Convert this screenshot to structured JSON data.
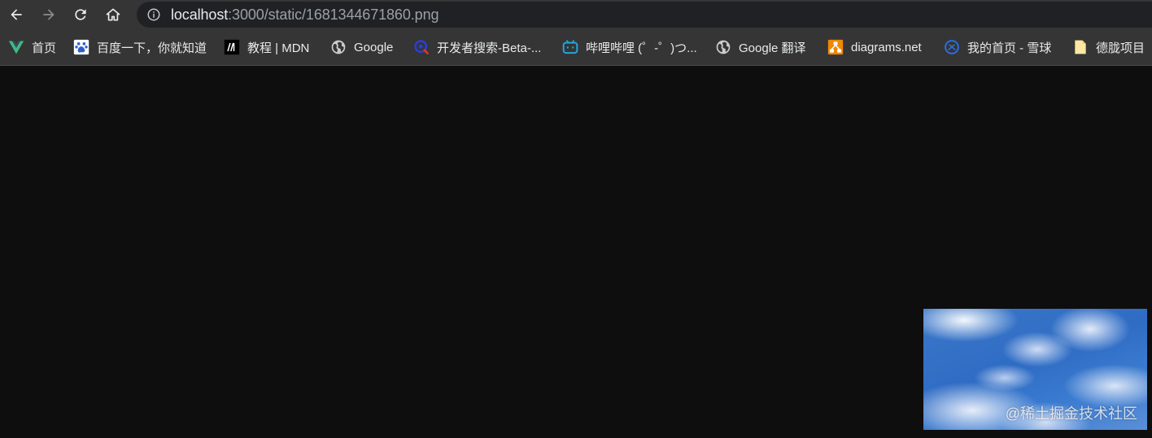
{
  "toolbar": {
    "back_icon": "arrow-left-icon",
    "forward_icon": "arrow-right-icon",
    "reload_icon": "reload-icon",
    "home_icon": "home-icon",
    "url_host": "localhost",
    "url_path": ":3000/static/1681344671860.png"
  },
  "bookmarks": [
    {
      "label": "首页",
      "icon": "vue-logo-icon"
    },
    {
      "label": "百度一下，你就知道",
      "icon": "baidu-paw-icon"
    },
    {
      "label": "教程 | MDN",
      "icon": "mdn-logo-icon"
    },
    {
      "label": "Google",
      "icon": "globe-icon"
    },
    {
      "label": "开发者搜索-Beta-...",
      "icon": "search-engine-icon"
    },
    {
      "label": "哔哩哔哩 (゜-゜)つ...",
      "icon": "bilibili-tv-icon"
    },
    {
      "label": "Google 翻译",
      "icon": "globe-icon"
    },
    {
      "label": "diagrams.net",
      "icon": "diagrams-logo-icon"
    },
    {
      "label": "我的首页 - 雪球",
      "icon": "xueqiu-logo-icon"
    },
    {
      "label": "德胧项目",
      "icon": "folder-icon"
    }
  ],
  "thumbnail": {
    "watermark": "@稀土掘金技术社区"
  }
}
